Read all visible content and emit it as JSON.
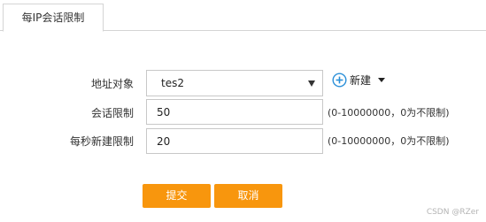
{
  "tabs": [
    {
      "label": "每IP会话限制",
      "active": true
    }
  ],
  "form": {
    "address_object": {
      "label": "地址对象",
      "selected": "tes2"
    },
    "new_button": {
      "label": "新建",
      "icon": "plus-circle-icon"
    },
    "session_limit": {
      "label": "会话限制",
      "value": "50",
      "hint": "(0-10000000，0为不限制)"
    },
    "new_per_second_limit": {
      "label": "每秒新建限制",
      "value": "20",
      "hint": "(0-10000000，0为不限制)"
    }
  },
  "actions": {
    "submit_label": "提交",
    "cancel_label": "取消"
  },
  "watermark": "CSDN @RZer",
  "colors": {
    "accent": "#f8960d",
    "icon_blue": "#2a8fd8",
    "border": "#c8c8c8"
  }
}
